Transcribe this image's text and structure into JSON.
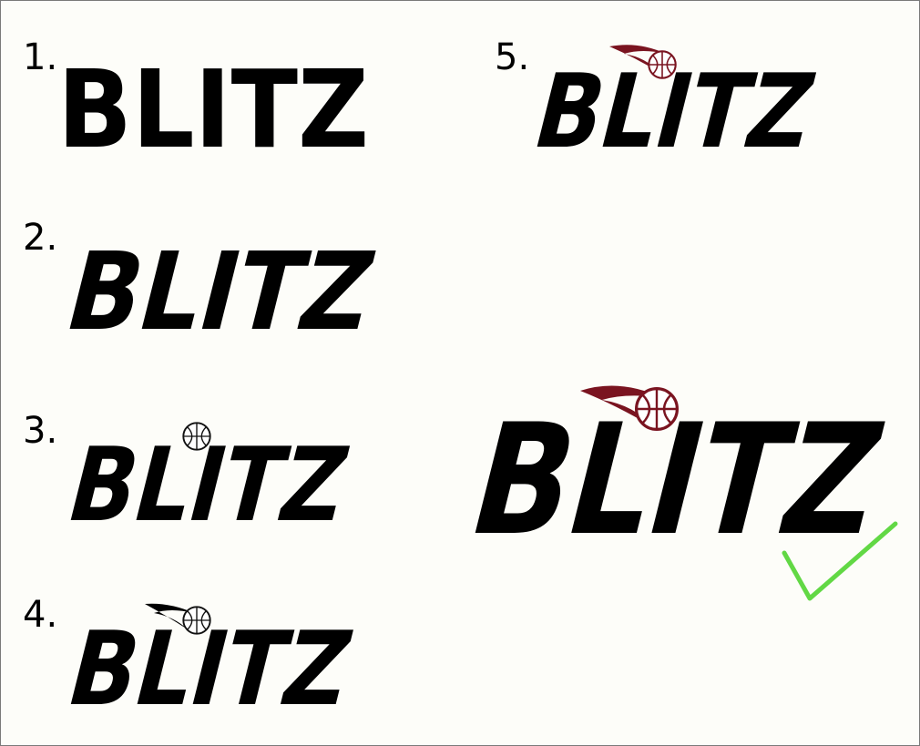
{
  "logos": [
    {
      "number": "1.",
      "text": "BLITZ",
      "style": "upright bold"
    },
    {
      "number": "2.",
      "text": "BLITZ",
      "style": "italic bold"
    },
    {
      "number": "3.",
      "text": "BLITZ",
      "style": "italic with basketball over I"
    },
    {
      "number": "4.",
      "text": "BLITZ",
      "style": "italic with basketball and black motion swoosh"
    },
    {
      "number": "5.",
      "text": "BLITZ",
      "style": "italic with maroon basketball and swoosh"
    }
  ],
  "selected": {
    "text": "BLITZ",
    "mark": "check-mark"
  },
  "colors": {
    "ink": "#000000",
    "maroon": "#7a1420",
    "ball_white": "#ffffff",
    "check": "#62d845",
    "background": "#fdfdf9"
  }
}
